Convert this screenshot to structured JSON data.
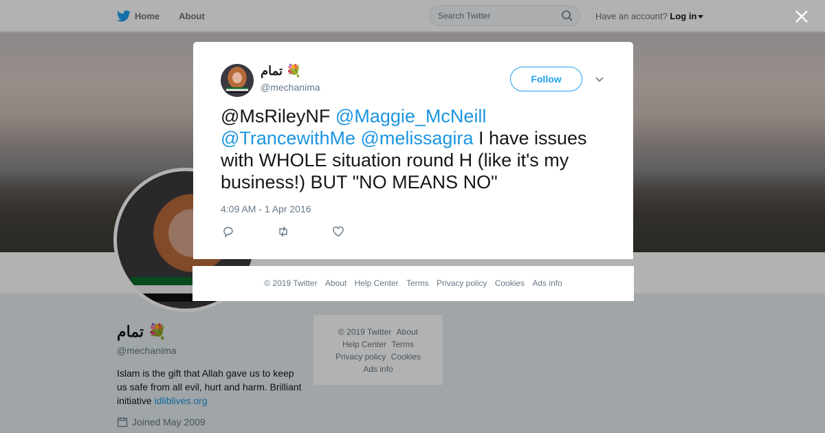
{
  "nav": {
    "home_label": "Home",
    "about_label": "About",
    "search_placeholder": "Search Twitter",
    "account_prompt": "Have an account?",
    "login_label": "Log in"
  },
  "profile": {
    "name": "تمام 💐",
    "handle": "@mechanima",
    "bio_text": "Islam is the gift that Allah gave us to keep us safe from all evil, hurt and harm. Brilliant initiative ",
    "bio_link": "idliblives.org",
    "joined": "Joined May 2009"
  },
  "sidebar_footer": {
    "copyright": "© 2019 Twitter",
    "about": "About",
    "help": "Help Center",
    "terms": "Terms",
    "privacy": "Privacy policy",
    "cookies": "Cookies",
    "ads": "Ads info"
  },
  "tweet": {
    "name": "تمام 💐",
    "handle": "@mechanima",
    "follow_label": "Follow",
    "mention1": "@MsRileyNF",
    "mention2": "@Maggie_McNeill",
    "mention3": "@TrancewithMe",
    "mention4": "@melissagira",
    "text": " I have issues with WHOLE situation round H (like it's my business!) BUT \"NO MEANS NO\"",
    "timestamp": "4:09 AM - 1 Apr 2016"
  },
  "modal_footer": {
    "copyright": "© 2019 Twitter",
    "about": "About",
    "help": "Help Center",
    "terms": "Terms",
    "privacy": "Privacy policy",
    "cookies": "Cookies",
    "ads": "Ads info"
  },
  "colors": {
    "brand": "#1da1f2",
    "link": "#1b95e0"
  }
}
